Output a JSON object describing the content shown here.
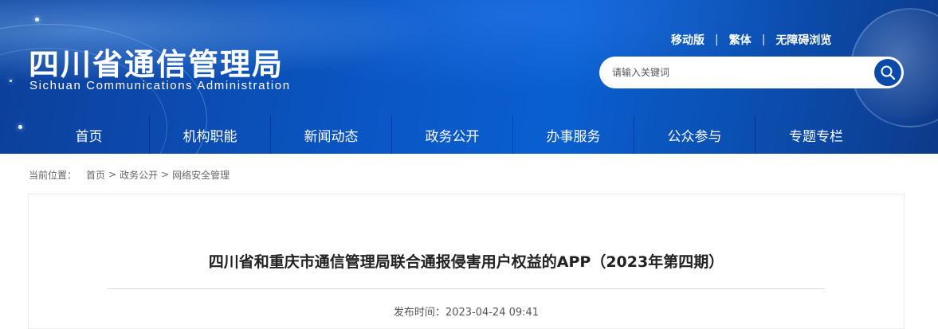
{
  "site": {
    "name_cn": "四川省通信管理局",
    "name_en": "Sichuan Communications Administration"
  },
  "top_links": [
    "移动版",
    "繁体",
    "无障碍浏览"
  ],
  "search": {
    "placeholder": "请输入关键词",
    "icon": "search-icon"
  },
  "nav": [
    "首页",
    "机构职能",
    "新闻动态",
    "政务公开",
    "办事服务",
    "公众参与",
    "专题专栏"
  ],
  "breadcrumb": {
    "label": "当前位置：",
    "items": [
      "首页",
      "政务公开",
      "网络安全管理"
    ],
    "separator": ">"
  },
  "article": {
    "title": "四川省和重庆市通信管理局联合通报侵害用户权益的APP（2023年第四期）",
    "publish_label": "发布时间：",
    "publish_time": "2023-04-24 09:41"
  },
  "colors": {
    "header_blue": "#0a56c4",
    "nav_divider": "#0a1e50",
    "search_button": "#0b4aa8"
  }
}
